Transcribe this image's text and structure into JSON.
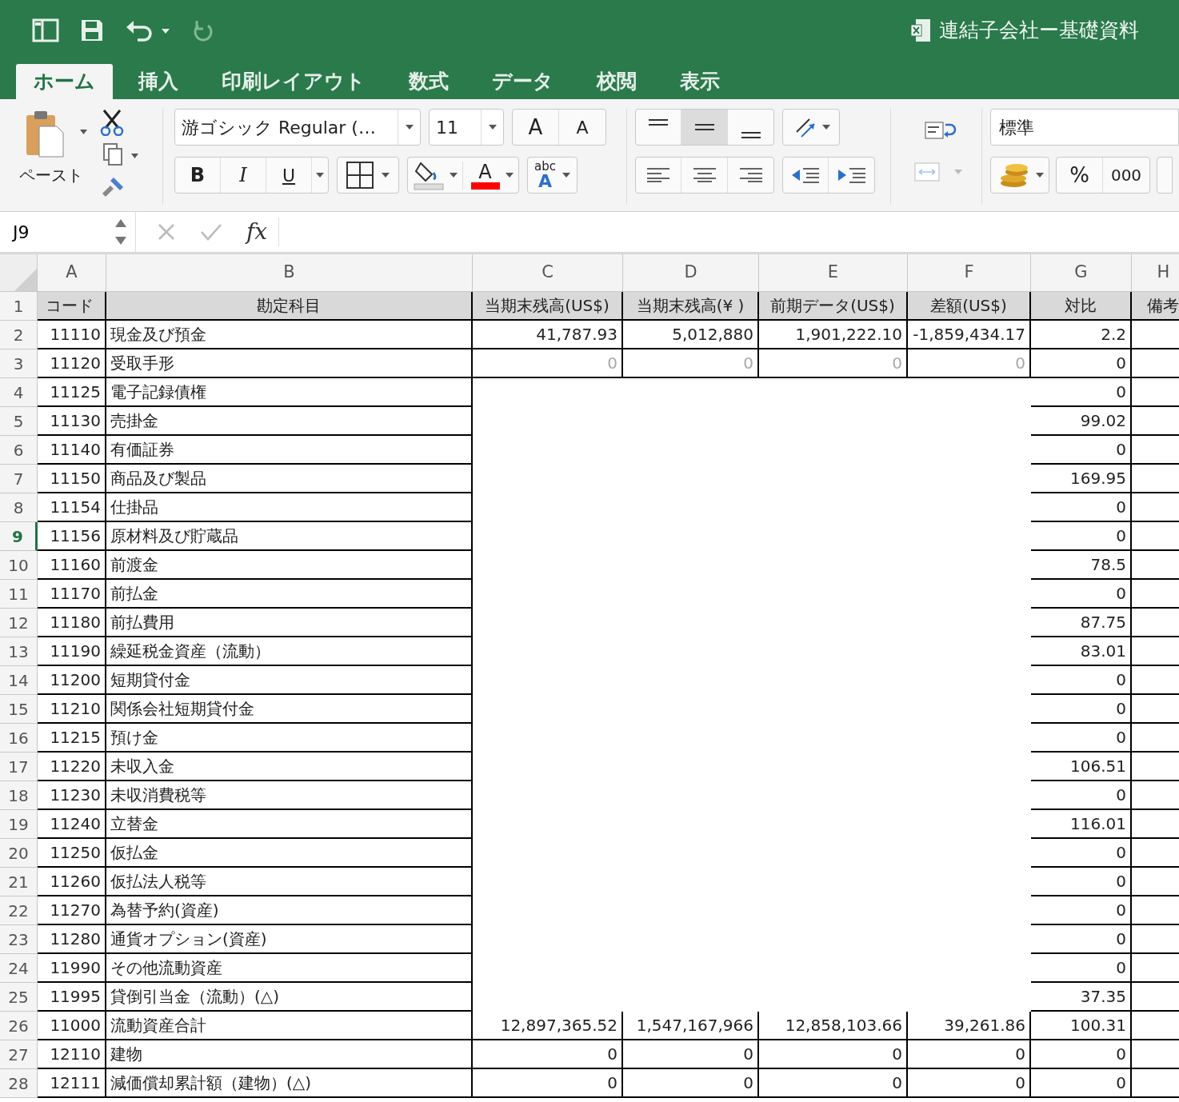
{
  "window": {
    "title": "連結子会社ー基礎資料"
  },
  "tabs": [
    {
      "label": "ホーム",
      "selected": true
    },
    {
      "label": "挿入",
      "selected": false
    },
    {
      "label": "印刷レイアウト",
      "selected": false
    },
    {
      "label": "数式",
      "selected": false
    },
    {
      "label": "データ",
      "selected": false
    },
    {
      "label": "校閲",
      "selected": false
    },
    {
      "label": "表示",
      "selected": false
    }
  ],
  "ribbon": {
    "paste_label": "ペースト",
    "font_name": "游ゴシック Regular (…",
    "font_size": "11",
    "grow_label": "A",
    "shrink_label": "A",
    "bold_label": "B",
    "italic_label": "I",
    "underline_label": "U",
    "font_color_label": "A",
    "spelling_labels": [
      "abc",
      "A"
    ],
    "number_format": "標準",
    "percent_label": "%",
    "thousands_label": "000"
  },
  "formula_bar": {
    "cell_ref": "J9",
    "fx_label": "fx"
  },
  "columns": [
    {
      "label": "A"
    },
    {
      "label": "B"
    },
    {
      "label": "C"
    },
    {
      "label": "D"
    },
    {
      "label": "E"
    },
    {
      "label": "F"
    },
    {
      "label": "G"
    },
    {
      "label": "H"
    }
  ],
  "header_row": {
    "num": "1",
    "selected": false,
    "labels": [
      "コード",
      "勘定科目",
      "当期末残高(US$)",
      "当期末残高(¥ )",
      "前期データ(US$)",
      "差額(US$)",
      "対比",
      "備考"
    ]
  },
  "rows": [
    {
      "num": "2",
      "selected": false,
      "code": "11110",
      "account": "現金及び預金",
      "c": "41,787.93",
      "d": "5,012,880",
      "e": "1,901,222.10",
      "f": "-1,859,434.17",
      "g": "2.2"
    },
    {
      "num": "3",
      "selected": false,
      "code": "11120",
      "account": "受取手形",
      "c": "0",
      "d": "0",
      "e": "0",
      "f": "0",
      "g": "0"
    },
    {
      "num": "4",
      "selected": false,
      "code": "11125",
      "account": "電子記録債権",
      "g": "0"
    },
    {
      "num": "5",
      "selected": false,
      "code": "11130",
      "account": "売掛金",
      "g": "99.02"
    },
    {
      "num": "6",
      "selected": false,
      "code": "11140",
      "account": "有価証券",
      "g": "0"
    },
    {
      "num": "7",
      "selected": false,
      "code": "11150",
      "account": "商品及び製品",
      "g": "169.95"
    },
    {
      "num": "8",
      "selected": false,
      "code": "11154",
      "account": "仕掛品",
      "g": "0"
    },
    {
      "num": "9",
      "selected": true,
      "code": "11156",
      "account": "原材料及び貯蔵品",
      "g": "0"
    },
    {
      "num": "10",
      "selected": false,
      "code": "11160",
      "account": "前渡金",
      "g": "78.5"
    },
    {
      "num": "11",
      "selected": false,
      "code": "11170",
      "account": "前払金",
      "g": "0"
    },
    {
      "num": "12",
      "selected": false,
      "code": "11180",
      "account": "前払費用",
      "g": "87.75"
    },
    {
      "num": "13",
      "selected": false,
      "code": "11190",
      "account": "繰延税金資産（流動）",
      "g": "83.01"
    },
    {
      "num": "14",
      "selected": false,
      "code": "11200",
      "account": "短期貸付金",
      "g": "0"
    },
    {
      "num": "15",
      "selected": false,
      "code": "11210",
      "account": "関係会社短期貸付金",
      "g": "0"
    },
    {
      "num": "16",
      "selected": false,
      "code": "11215",
      "account": "預け金",
      "g": "0"
    },
    {
      "num": "17",
      "selected": false,
      "code": "11220",
      "account": "未収入金",
      "g": "106.51"
    },
    {
      "num": "18",
      "selected": false,
      "code": "11230",
      "account": "未収消費税等",
      "g": "0"
    },
    {
      "num": "19",
      "selected": false,
      "code": "11240",
      "account": "立替金",
      "g": "116.01"
    },
    {
      "num": "20",
      "selected": false,
      "code": "11250",
      "account": "仮払金",
      "g": "0"
    },
    {
      "num": "21",
      "selected": false,
      "code": "11260",
      "account": "仮払法人税等",
      "g": "0"
    },
    {
      "num": "22",
      "selected": false,
      "code": "11270",
      "account": "為替予約(資産)",
      "g": "0"
    },
    {
      "num": "23",
      "selected": false,
      "code": "11280",
      "account": "通貨オプション(資産)",
      "g": "0"
    },
    {
      "num": "24",
      "selected": false,
      "code": "11990",
      "account": "その他流動資産",
      "g": "0"
    },
    {
      "num": "25",
      "selected": false,
      "code": "11995",
      "account": "貸倒引当金（流動）(△)",
      "g": "37.35"
    },
    {
      "num": "26",
      "selected": false,
      "code": "11000",
      "account": "流動資産合計",
      "c": "12,897,365.52",
      "d": "1,547,167,966",
      "e": "12,858,103.66",
      "f": "39,261.86",
      "g": "100.31"
    },
    {
      "num": "27",
      "selected": false,
      "code": "12110",
      "account": "建物",
      "c": "0",
      "d": "0",
      "e": "0",
      "f": "0",
      "g": "0"
    },
    {
      "num": "28",
      "selected": false,
      "code": "12111",
      "account": "減価償却累計額（建物）(△)",
      "c": "0",
      "d": "0",
      "e": "0",
      "f": "0",
      "g": "0"
    }
  ]
}
